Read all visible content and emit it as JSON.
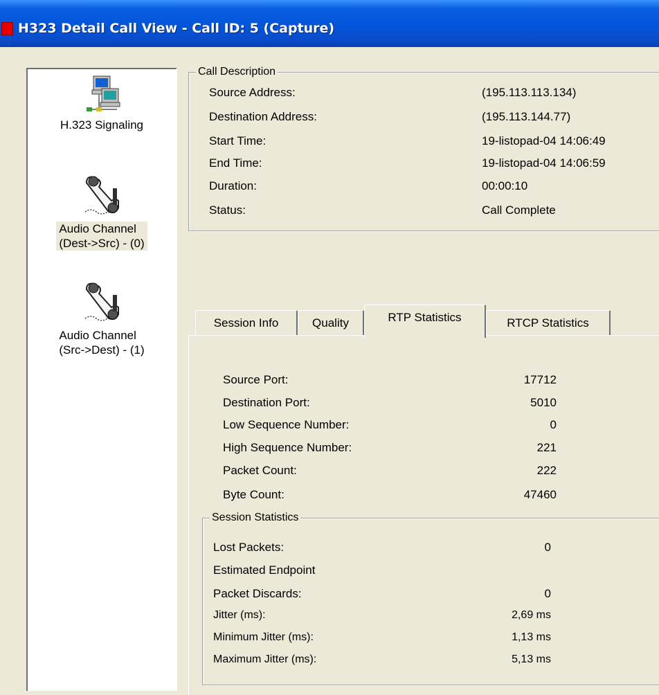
{
  "window": {
    "title": "H323 Detail Call View - Call ID: 5 (Capture)"
  },
  "nav": [
    {
      "label_line1": "H.323 Signaling",
      "label_line2": "",
      "icon": "network-computers-icon",
      "selected": false
    },
    {
      "label_line1": "Audio Channel",
      "label_line2": "(Dest->Src) - (0)",
      "icon": "telephone-handset-icon",
      "selected": true
    },
    {
      "label_line1": "Audio Channel",
      "label_line2": "(Src->Dest) - (1)",
      "icon": "telephone-handset-icon",
      "selected": false
    }
  ],
  "call_description": {
    "legend": "Call Description",
    "rows": [
      {
        "label": "Source Address:",
        "value": "(195.113.113.134)"
      },
      {
        "label": "Destination Address:",
        "value": "(195.113.144.77)"
      },
      {
        "label": "Start Time:",
        "value": "19-listopad-04  14:06:49"
      },
      {
        "label": "End Time:",
        "value": "19-listopad-04  14:06:59"
      },
      {
        "label": "Duration:",
        "value": "00:00:10"
      },
      {
        "label": "Status:",
        "value": "Call Complete"
      }
    ]
  },
  "tabs": [
    {
      "label": "Session Info",
      "active": false
    },
    {
      "label": "Quality",
      "active": false
    },
    {
      "label": "RTP Statistics",
      "active": true
    },
    {
      "label": "RTCP Statistics",
      "active": false
    }
  ],
  "rtp_stats": [
    {
      "label": "Source Port:",
      "value": "17712"
    },
    {
      "label": "Destination Port:",
      "value": "5010"
    },
    {
      "label": "Low Sequence Number:",
      "value": "0"
    },
    {
      "label": "High Sequence Number:",
      "value": "221"
    },
    {
      "label": "Packet Count:",
      "value": "222"
    },
    {
      "label": "Byte Count:",
      "value": "47460"
    }
  ],
  "session_statistics": {
    "legend": "Session Statistics",
    "rows": [
      {
        "label": "Lost Packets:",
        "value": "0"
      },
      {
        "label": "Estimated Endpoint",
        "value": ""
      },
      {
        "label": "Packet Discards:",
        "value": "0"
      },
      {
        "label": "Jitter (ms):",
        "value": "2,69 ms"
      },
      {
        "label": "Minimum Jitter (ms):",
        "value": "1,13 ms"
      },
      {
        "label": "Maximum Jitter (ms):",
        "value": "5,13 ms"
      }
    ]
  }
}
